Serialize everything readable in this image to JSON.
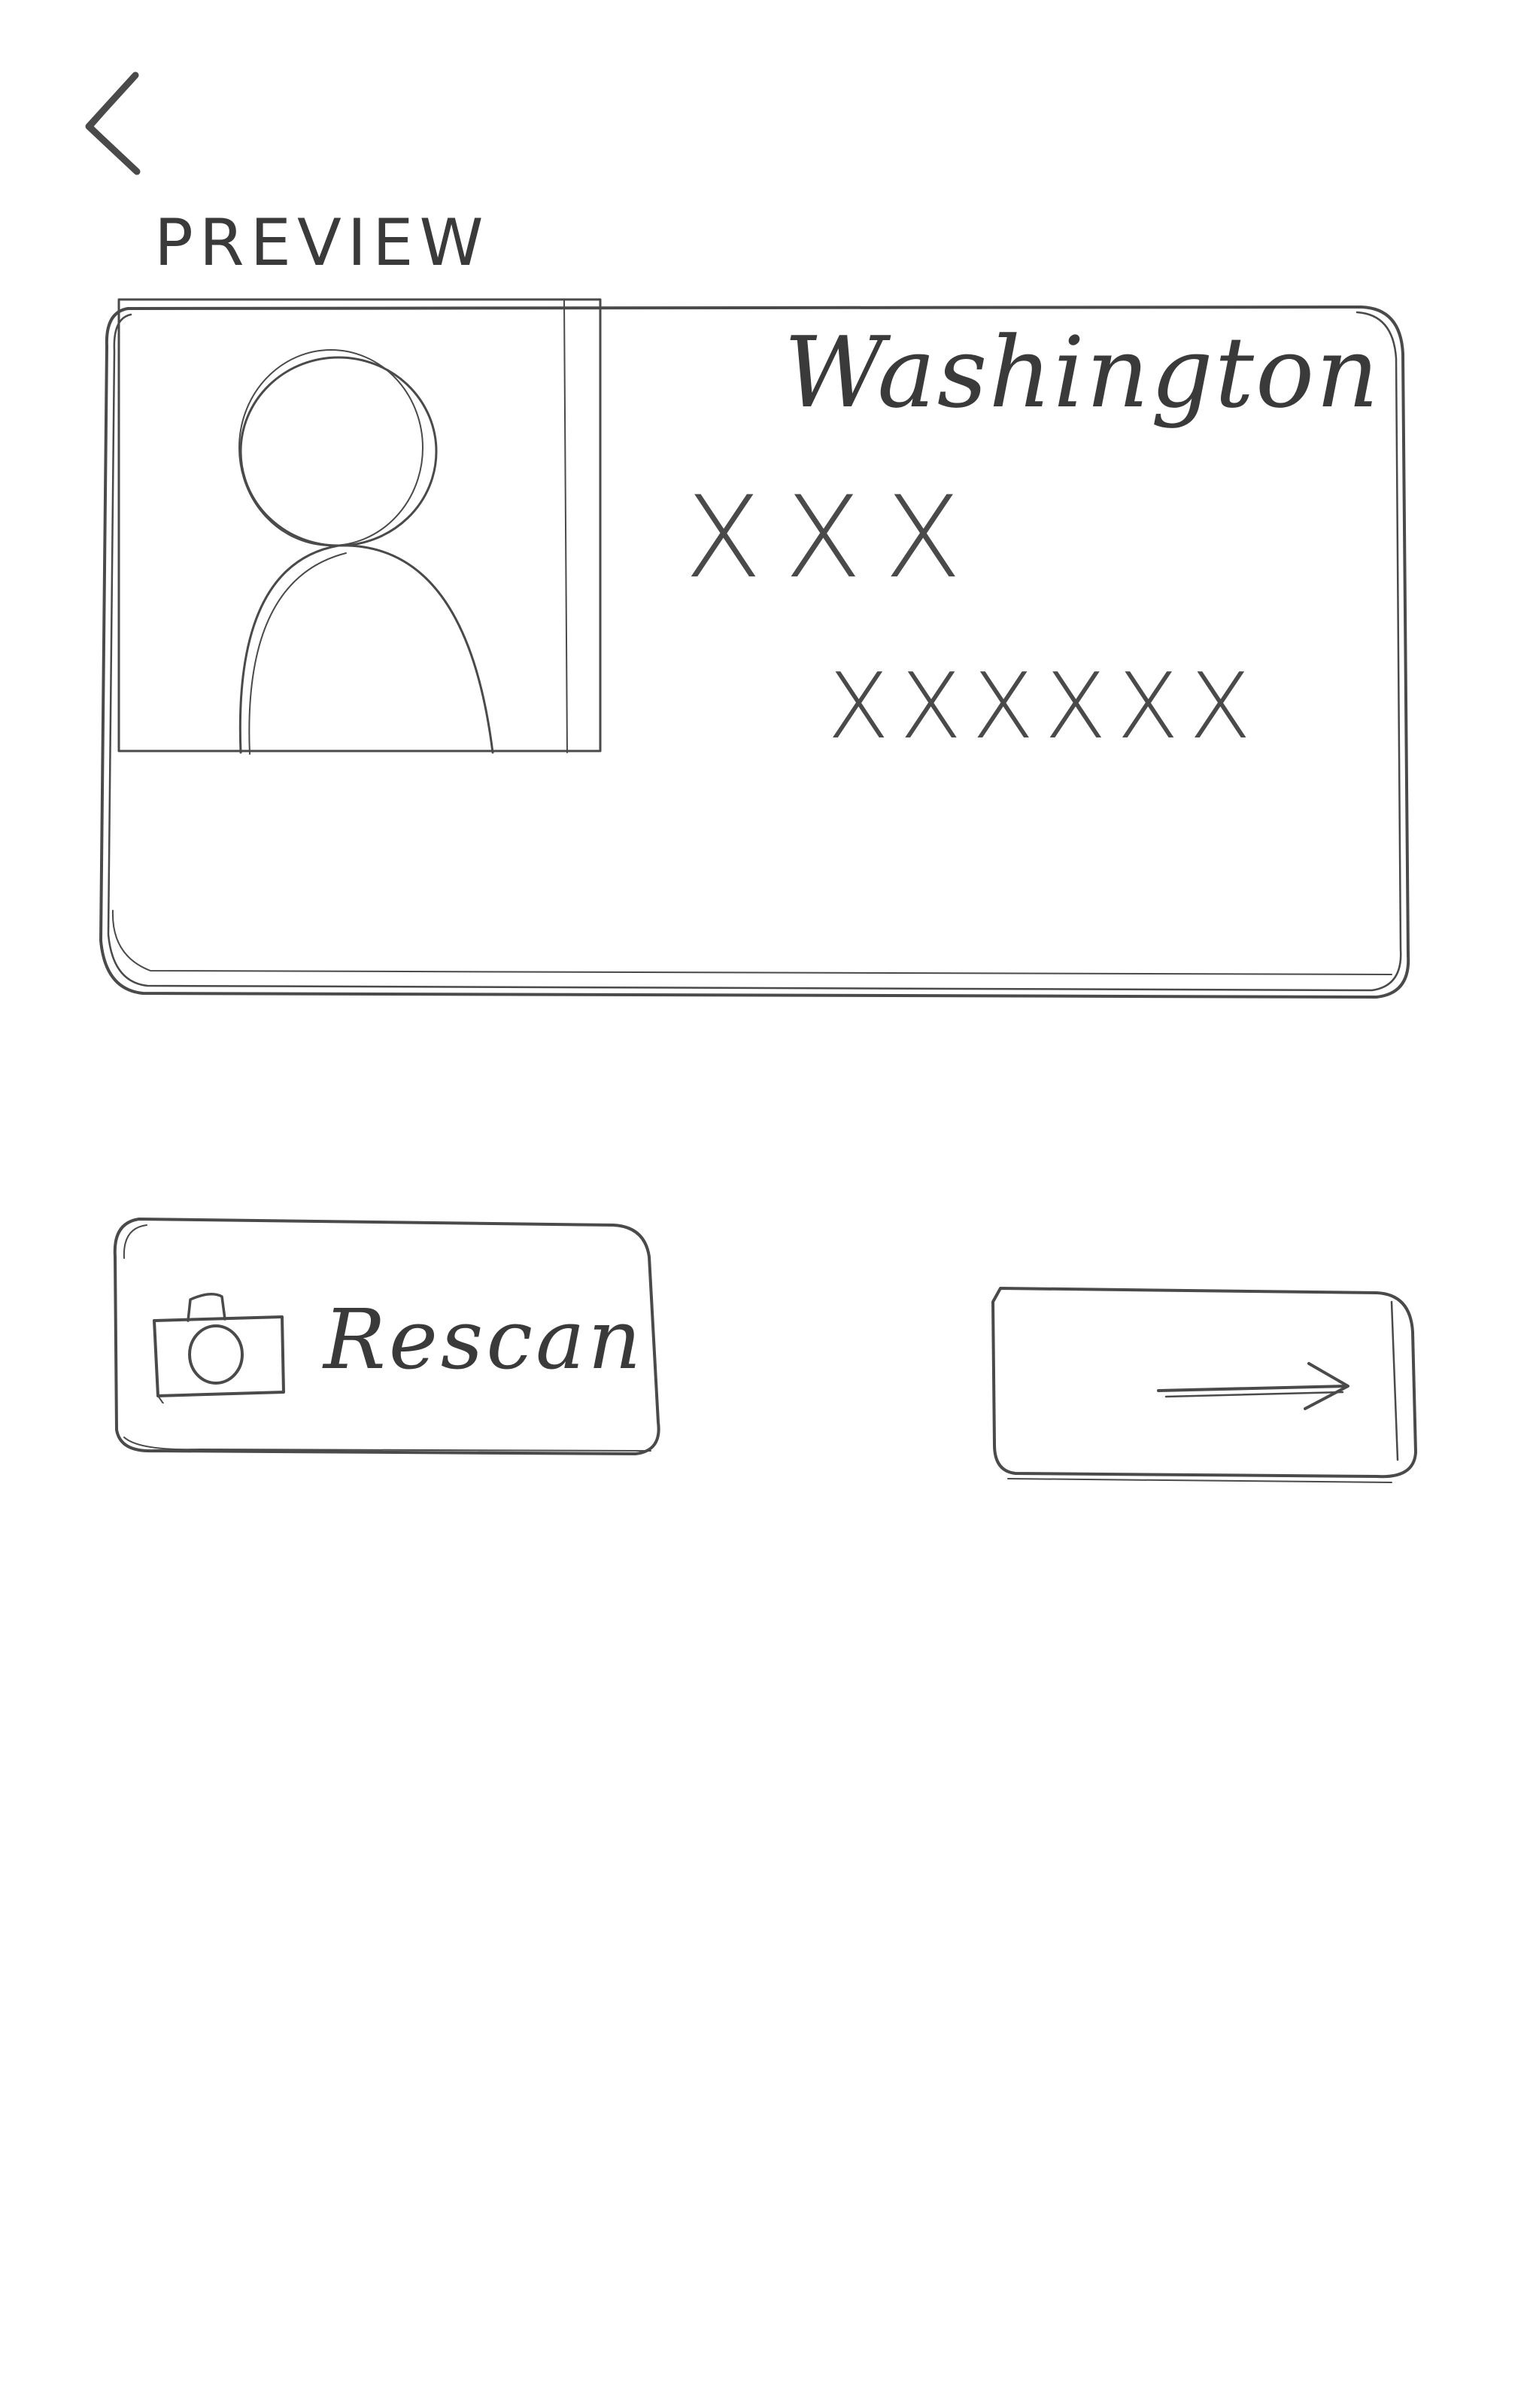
{
  "screen": {
    "preview_label": "PREVIEW"
  },
  "id_card": {
    "state_name": "Washington",
    "field_1": "XXX",
    "field_2": "XXXXXX"
  },
  "actions": {
    "rescan_label": "Rescan"
  },
  "icons": {
    "back": "chevron-left-icon",
    "photo": "person-placeholder-icon",
    "camera": "camera-icon",
    "next": "arrow-right-icon"
  }
}
